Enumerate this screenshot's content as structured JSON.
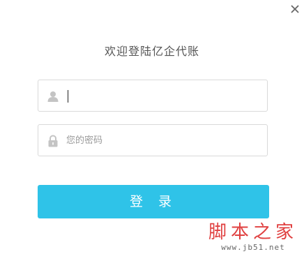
{
  "title": "欢迎登陆亿企代账",
  "username": {
    "value": "",
    "placeholder": "",
    "icon": "user-icon"
  },
  "password": {
    "value": "",
    "placeholder": "您的密码",
    "icon": "lock-icon"
  },
  "login_label": "登 录",
  "close_icon": "close-icon",
  "watermark": {
    "title": "脚本之家",
    "url": "www.jb51.net"
  },
  "colors": {
    "accent": "#2fc3e8",
    "watermark": "#e04040",
    "border": "#d9d9d9"
  }
}
